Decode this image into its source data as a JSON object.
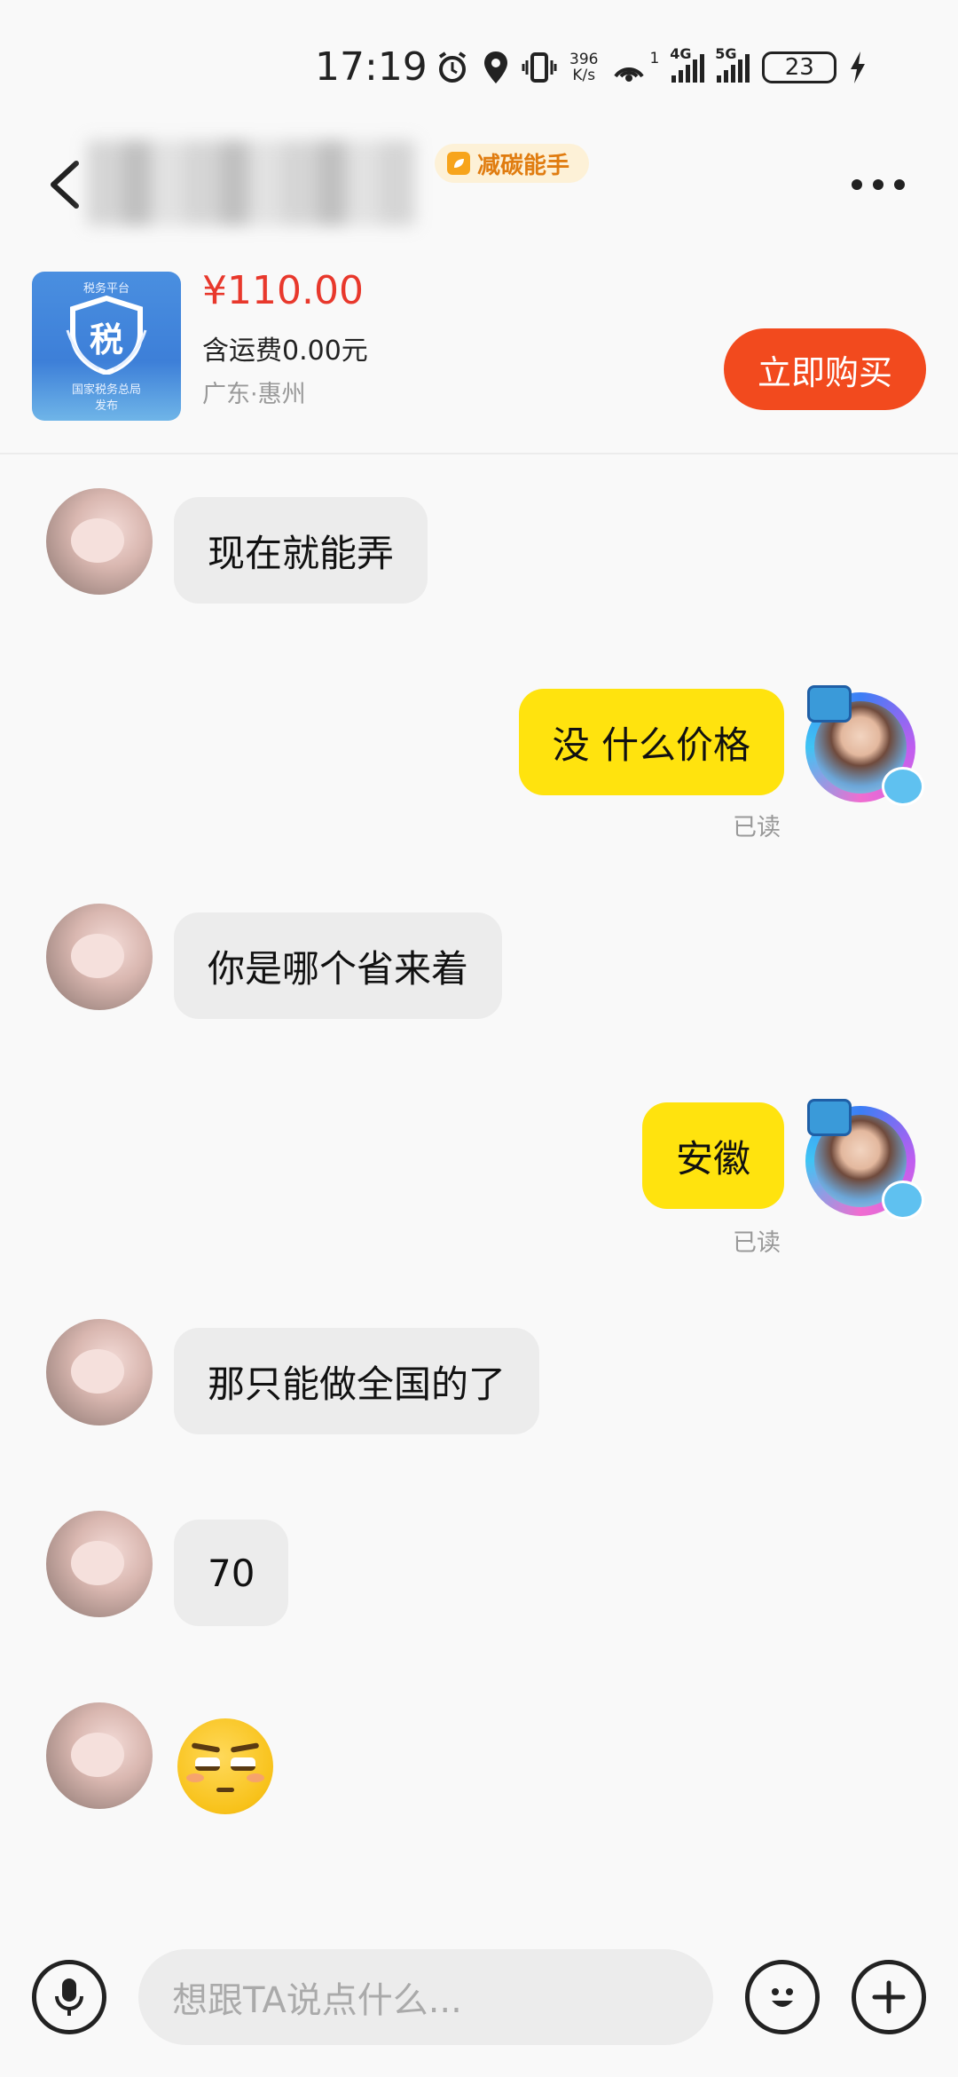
{
  "status_bar": {
    "time": "17:19",
    "net_speed_value": "396",
    "net_speed_unit": "K/s",
    "hotspot_label": "1",
    "signal_1_label": "4G",
    "signal_2_label": "5G",
    "battery_level": "23",
    "icons": [
      "alarm-icon",
      "location-icon",
      "vibrate-icon",
      "hotspot-icon",
      "signal-icon",
      "battery-icon",
      "charging-icon"
    ]
  },
  "header": {
    "badge_label": "减碳能手",
    "icons": [
      "back-icon",
      "more-icon"
    ]
  },
  "product": {
    "price": "¥110.00",
    "shipping": "含运费0.00元",
    "location": "广东·惠州",
    "image_text_top": "税务平台",
    "image_glyph": "税",
    "image_text_bottom_1": "国家税务总局",
    "image_text_bottom_2": "发布",
    "buy_label": "立即购买"
  },
  "messages": [
    {
      "side": "left",
      "text": "现在就能弄"
    },
    {
      "side": "right",
      "text": "没 什么价格",
      "status": "已读"
    },
    {
      "side": "left",
      "text": "你是哪个省来着"
    },
    {
      "side": "right",
      "text": "安徽",
      "status": "已读"
    },
    {
      "side": "left",
      "text": "那只能做全国的了"
    },
    {
      "side": "left",
      "text": "70"
    },
    {
      "side": "left",
      "type": "emoji",
      "emoji": "smirk-emoji"
    }
  ],
  "input": {
    "placeholder": "想跟TA说点什么..."
  },
  "colors": {
    "accent_yellow": "#ffe30e",
    "price_red": "#e8382c",
    "buy_button": "#f24a1e",
    "badge_text": "#e07c10"
  }
}
